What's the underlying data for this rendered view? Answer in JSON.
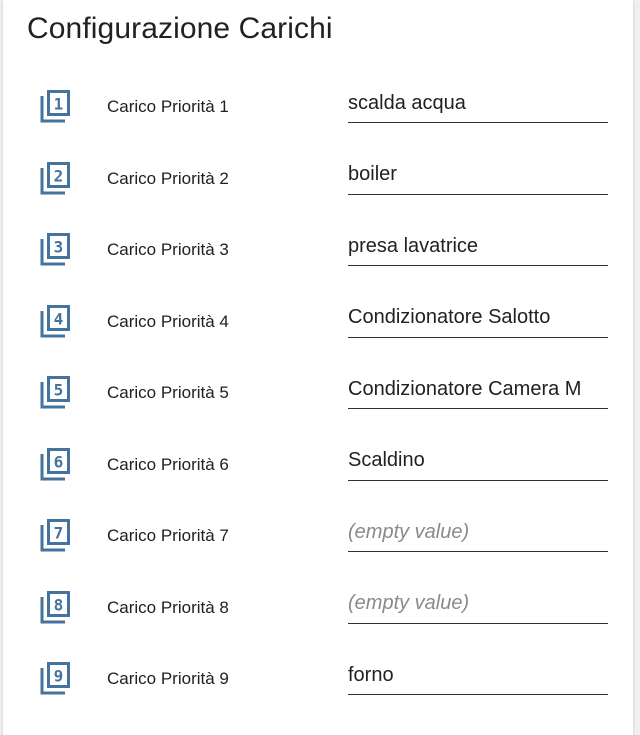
{
  "card": {
    "title": "Configurazione Carichi"
  },
  "colors": {
    "icon": "#44739e",
    "text": "#212121",
    "placeholder": "#8a8a8a"
  },
  "rows": [
    {
      "icon": "priority-1-icon",
      "number": "1",
      "label": "Carico Priorità 1",
      "value": "scalda acqua",
      "placeholder": ""
    },
    {
      "icon": "priority-2-icon",
      "number": "2",
      "label": "Carico Priorità 2",
      "value": "boiler",
      "placeholder": ""
    },
    {
      "icon": "priority-3-icon",
      "number": "3",
      "label": "Carico Priorità 3",
      "value": "presa lavatrice",
      "placeholder": ""
    },
    {
      "icon": "priority-4-icon",
      "number": "4",
      "label": "Carico Priorità 4",
      "value": "Condizionatore Salotto",
      "placeholder": ""
    },
    {
      "icon": "priority-5-icon",
      "number": "5",
      "label": "Carico Priorità 5",
      "value": "Condizionatore Camera M",
      "placeholder": ""
    },
    {
      "icon": "priority-6-icon",
      "number": "6",
      "label": "Carico Priorità 6",
      "value": "Scaldino",
      "placeholder": ""
    },
    {
      "icon": "priority-7-icon",
      "number": "7",
      "label": "Carico Priorità 7",
      "value": "",
      "placeholder": "(empty value)"
    },
    {
      "icon": "priority-8-icon",
      "number": "8",
      "label": "Carico Priorità 8",
      "value": "",
      "placeholder": "(empty value)"
    },
    {
      "icon": "priority-9-icon",
      "number": "9",
      "label": "Carico Priorità 9",
      "value": "forno",
      "placeholder": ""
    }
  ]
}
